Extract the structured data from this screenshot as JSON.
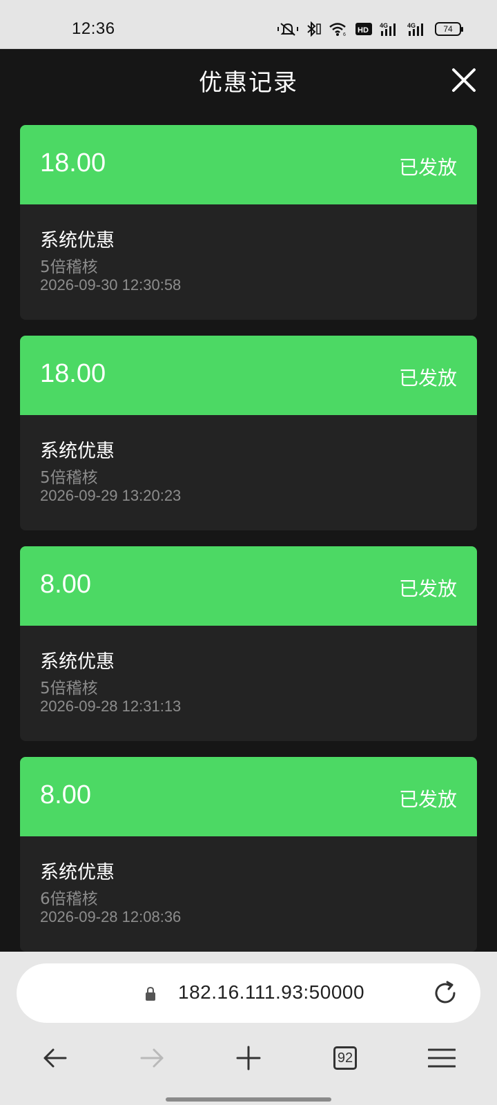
{
  "status_bar": {
    "time": "12:36",
    "icons": [
      "mute-vibrate-icon",
      "bluetooth-icon",
      "wifi-icon",
      "hd-icon",
      "signal-4g-icon",
      "signal-4g-icon"
    ],
    "battery": "74"
  },
  "header": {
    "title": "优惠记录",
    "close_icon": "close-icon"
  },
  "records": [
    {
      "amount": "18.00",
      "status": "已发放",
      "type": "系统优惠",
      "desc": "5倍稽核",
      "time": "2026-09-30 12:30:58"
    },
    {
      "amount": "18.00",
      "status": "已发放",
      "type": "系统优惠",
      "desc": "5倍稽核",
      "time": "2026-09-29 13:20:23"
    },
    {
      "amount": "8.00",
      "status": "已发放",
      "type": "系统优惠",
      "desc": "5倍稽核",
      "time": "2026-09-28 12:31:13"
    },
    {
      "amount": "8.00",
      "status": "已发放",
      "type": "系统优惠",
      "desc": "6倍稽核",
      "time": "2026-09-28 12:08:36"
    }
  ],
  "browser": {
    "url": "182.16.111.93:50000",
    "tab_count": "92"
  },
  "colors": {
    "accent_green": "#4cd964",
    "background": "#161616",
    "card_body": "#232323",
    "muted_text": "#8d8d8d"
  }
}
